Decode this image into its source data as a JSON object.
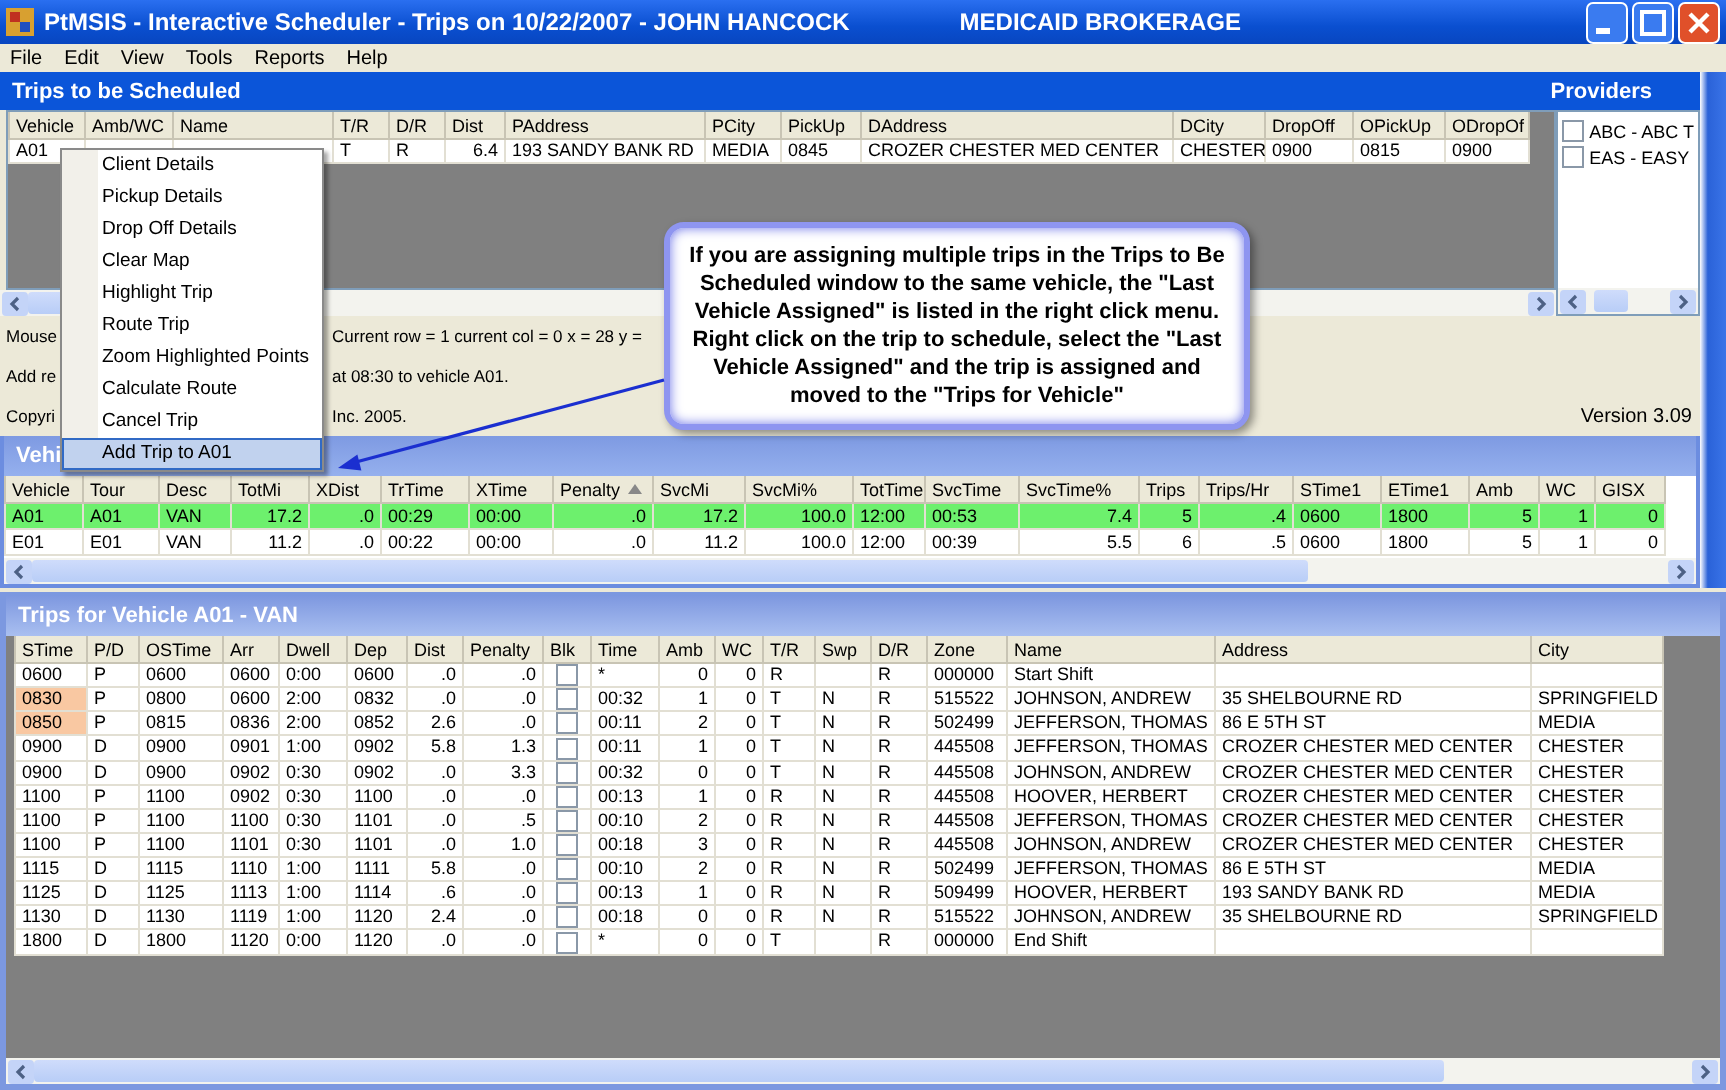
{
  "window": {
    "title": "PtMSIS - Interactive Scheduler - Trips on 10/22/2007 - JOHN HANCOCK",
    "subtitle": "MEDICAID BROKERAGE"
  },
  "menu": [
    "File",
    "Edit",
    "View",
    "Tools",
    "Reports",
    "Help"
  ],
  "scheduled": {
    "title": "Trips to be Scheduled",
    "columns": [
      {
        "label": "Vehicle",
        "kind": "text"
      },
      {
        "label": "Amb/WC",
        "kind": "text"
      },
      {
        "label": "Name",
        "kind": "text"
      },
      {
        "label": "T/R",
        "kind": "text"
      },
      {
        "label": "D/R",
        "kind": "text"
      },
      {
        "label": "Dist",
        "kind": "number"
      },
      {
        "label": "PAddress",
        "kind": "text"
      },
      {
        "label": "PCity",
        "kind": "text"
      },
      {
        "label": "PickUp",
        "kind": "text"
      },
      {
        "label": "DAddress",
        "kind": "text"
      },
      {
        "label": "DCity",
        "kind": "text"
      },
      {
        "label": "DropOff",
        "kind": "text"
      },
      {
        "label": "OPickUp",
        "kind": "text"
      },
      {
        "label": "ODropOf",
        "kind": "text"
      }
    ],
    "rows": [
      {
        "cells": [
          "A01",
          null,
          null,
          "T",
          "R",
          "6.4",
          "193 SANDY BANK RD",
          "MEDIA",
          "0845",
          "CROZER CHESTER MED CENTER",
          "CHESTER",
          "0900",
          "0815",
          "0900"
        ]
      }
    ]
  },
  "providers": {
    "title": "Providers",
    "items": [
      {
        "label": "ABC - ABC T",
        "checked": false
      },
      {
        "label": "EAS - EASY",
        "checked": false
      }
    ]
  },
  "status_lines": [
    {
      "left": "Mouse",
      "right": "Current row = 1 current col = 0 x = 28 y ="
    },
    {
      "left": "Add re",
      "right": "at 08:30 to vehicle A01."
    },
    {
      "left": "Copyri",
      "right": "Inc. 2005."
    }
  ],
  "version": "Version 3.09",
  "vehicles": {
    "title": "Vehi",
    "columns": [
      {
        "label": "Vehicle",
        "kind": "text"
      },
      {
        "label": "Tour",
        "kind": "text"
      },
      {
        "label": "Desc",
        "kind": "text"
      },
      {
        "label": "TotMi",
        "kind": "number"
      },
      {
        "label": "XDist",
        "kind": "number"
      },
      {
        "label": "TrTime",
        "kind": "text"
      },
      {
        "label": "XTime",
        "kind": "text"
      },
      {
        "label": "Penalty",
        "kind": "number",
        "sorted": true
      },
      {
        "label": "SvcMi",
        "kind": "number"
      },
      {
        "label": "SvcMi%",
        "kind": "number"
      },
      {
        "label": "TotTime",
        "kind": "text"
      },
      {
        "label": "SvcTime",
        "kind": "text"
      },
      {
        "label": "SvcTime%",
        "kind": "number"
      },
      {
        "label": "Trips",
        "kind": "number"
      },
      {
        "label": "Trips/Hr",
        "kind": "number"
      },
      {
        "label": "STime1",
        "kind": "text"
      },
      {
        "label": "ETime1",
        "kind": "text"
      },
      {
        "label": "Amb",
        "kind": "number"
      },
      {
        "label": "WC",
        "kind": "number"
      },
      {
        "label": "GISX",
        "kind": "number"
      }
    ],
    "rows": [
      {
        "selected": true,
        "cells": [
          "A01",
          "A01",
          "VAN",
          "17.2",
          ".0",
          "00:29",
          "00:00",
          ".0",
          "17.2",
          "100.0",
          "12:00",
          "00:53",
          "7.4",
          "5",
          ".4",
          "0600",
          "1800",
          "5",
          "1",
          "0"
        ]
      },
      {
        "selected": false,
        "cells": [
          "E01",
          "E01",
          "VAN",
          "11.2",
          ".0",
          "00:22",
          "00:00",
          ".0",
          "11.2",
          "100.0",
          "12:00",
          "00:39",
          "5.5",
          "6",
          ".5",
          "0600",
          "1800",
          "5",
          "1",
          "0"
        ]
      }
    ]
  },
  "trips": {
    "title": "Trips for Vehicle A01 - VAN",
    "columns": [
      {
        "label": "STime",
        "kind": "text"
      },
      {
        "label": "P/D",
        "kind": "text"
      },
      {
        "label": "OSTime",
        "kind": "text"
      },
      {
        "label": "Arr",
        "kind": "text"
      },
      {
        "label": "Dwell",
        "kind": "text"
      },
      {
        "label": "Dep",
        "kind": "text"
      },
      {
        "label": "Dist",
        "kind": "number"
      },
      {
        "label": "Penalty",
        "kind": "number"
      },
      {
        "label": "Blk",
        "kind": "check"
      },
      {
        "label": "Time",
        "kind": "text"
      },
      {
        "label": "Amb",
        "kind": "number"
      },
      {
        "label": "WC",
        "kind": "number"
      },
      {
        "label": "T/R",
        "kind": "text"
      },
      {
        "label": "Swp",
        "kind": "text"
      },
      {
        "label": "D/R",
        "kind": "text"
      },
      {
        "label": "Zone",
        "kind": "text"
      },
      {
        "label": "Name",
        "kind": "text"
      },
      {
        "label": "Address",
        "kind": "text"
      },
      {
        "label": "City",
        "kind": "text"
      }
    ],
    "rows": [
      {
        "flagged": false,
        "cells": [
          "0600",
          "P",
          "0600",
          "0600",
          "0:00",
          "0600",
          ".0",
          ".0",
          false,
          "*",
          "0",
          "0",
          "R",
          null,
          "R",
          "000000",
          "Start Shift",
          null,
          null
        ]
      },
      {
        "flagged": true,
        "cells": [
          "0830",
          "P",
          "0800",
          "0600",
          "2:00",
          "0832",
          ".0",
          ".0",
          false,
          "00:32",
          "1",
          "0",
          "T",
          "N",
          "R",
          "515522",
          "JOHNSON, ANDREW",
          "35 SHELBOURNE RD",
          "SPRINGFIELD"
        ]
      },
      {
        "flagged": true,
        "cells": [
          "0850",
          "P",
          "0815",
          "0836",
          "2:00",
          "0852",
          "2.6",
          ".0",
          false,
          "00:11",
          "2",
          "0",
          "T",
          "N",
          "R",
          "502499",
          "JEFFERSON, THOMAS",
          "86 E 5TH ST",
          "MEDIA"
        ]
      },
      {
        "flagged": false,
        "cells": [
          "0900",
          "D",
          "0900",
          "0901",
          "1:00",
          "0902",
          "5.8",
          "1.3",
          false,
          "00:11",
          "1",
          "0",
          "T",
          "N",
          "R",
          "445508",
          "JEFFERSON, THOMAS",
          "CROZER CHESTER MED CENTER",
          "CHESTER"
        ]
      },
      {
        "flagged": false,
        "cells": [
          "0900",
          "D",
          "0900",
          "0902",
          "0:30",
          "0902",
          ".0",
          "3.3",
          false,
          "00:32",
          "0",
          "0",
          "T",
          "N",
          "R",
          "445508",
          "JOHNSON, ANDREW",
          "CROZER CHESTER MED CENTER",
          "CHESTER"
        ]
      },
      {
        "flagged": false,
        "cells": [
          "1100",
          "P",
          "1100",
          "0902",
          "0:30",
          "1100",
          ".0",
          ".0",
          false,
          "00:13",
          "1",
          "0",
          "R",
          "N",
          "R",
          "445508",
          "HOOVER, HERBERT",
          "CROZER CHESTER MED CENTER",
          "CHESTER"
        ]
      },
      {
        "flagged": false,
        "cells": [
          "1100",
          "P",
          "1100",
          "1100",
          "0:30",
          "1101",
          ".0",
          ".5",
          false,
          "00:10",
          "2",
          "0",
          "R",
          "N",
          "R",
          "445508",
          "JEFFERSON, THOMAS",
          "CROZER CHESTER MED CENTER",
          "CHESTER"
        ]
      },
      {
        "flagged": false,
        "cells": [
          "1100",
          "P",
          "1100",
          "1101",
          "0:30",
          "1101",
          ".0",
          "1.0",
          false,
          "00:18",
          "3",
          "0",
          "R",
          "N",
          "R",
          "445508",
          "JOHNSON, ANDREW",
          "CROZER CHESTER MED CENTER",
          "CHESTER"
        ]
      },
      {
        "flagged": false,
        "cells": [
          "1115",
          "D",
          "1115",
          "1110",
          "1:00",
          "1111",
          "5.8",
          ".0",
          false,
          "00:10",
          "2",
          "0",
          "R",
          "N",
          "R",
          "502499",
          "JEFFERSON, THOMAS",
          "86 E 5TH ST",
          "MEDIA"
        ]
      },
      {
        "flagged": false,
        "cells": [
          "1125",
          "D",
          "1125",
          "1113",
          "1:00",
          "1114",
          ".6",
          ".0",
          false,
          "00:13",
          "1",
          "0",
          "R",
          "N",
          "R",
          "509499",
          "HOOVER, HERBERT",
          "193 SANDY BANK RD",
          "MEDIA"
        ]
      },
      {
        "flagged": false,
        "cells": [
          "1130",
          "D",
          "1130",
          "1119",
          "1:00",
          "1120",
          "2.4",
          ".0",
          false,
          "00:18",
          "0",
          "0",
          "R",
          "N",
          "R",
          "515522",
          "JOHNSON, ANDREW",
          "35 SHELBOURNE RD",
          "SPRINGFIELD"
        ]
      },
      {
        "flagged": false,
        "cells": [
          "1800",
          "D",
          "1800",
          "1120",
          "0:00",
          "1120",
          ".0",
          ".0",
          false,
          "*",
          "0",
          "0",
          "T",
          null,
          "R",
          "000000",
          "End Shift",
          null,
          null
        ]
      }
    ]
  },
  "context_menu": [
    {
      "label": "Client Details",
      "selected": false
    },
    {
      "label": "Pickup Details",
      "selected": false
    },
    {
      "label": "Drop Off Details",
      "selected": false
    },
    {
      "label": "Clear Map",
      "selected": false
    },
    {
      "label": "Highlight Trip",
      "selected": false
    },
    {
      "label": "Route Trip",
      "selected": false
    },
    {
      "label": "Zoom Highlighted Points",
      "selected": false
    },
    {
      "label": "Calculate Route",
      "selected": false
    },
    {
      "label": "Cancel Trip",
      "selected": false
    },
    {
      "label": "Add Trip to A01",
      "selected": true
    }
  ],
  "callout": "If you are assigning multiple trips in the Trips to Be Scheduled window to the same vehicle, the \"Last Vehicle Assigned\" is listed in the right click menu.  Right click on the trip to schedule, select the \"Last Vehicle Assigned\" and the trip is assigned and moved to the \"Trips for Vehicle\""
}
